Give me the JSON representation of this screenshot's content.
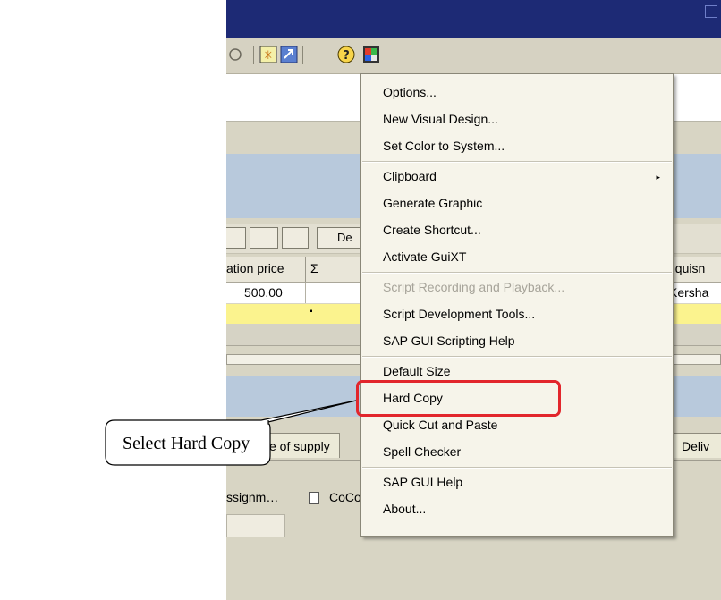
{
  "table": {
    "header_valuation": "ation price",
    "header_sigma": "Σ",
    "header_req": "equisn",
    "row_value": "500.00",
    "row_name": "Kersha",
    "yellow_marker": "▪"
  },
  "alv": {
    "detail_label": "De"
  },
  "tabs": [
    {
      "label": "ce of supply"
    },
    {
      "label": "Deliv"
    }
  ],
  "fields": {
    "assignment_label": "ssignm…",
    "coco_label": "CoCo"
  },
  "menu": {
    "items": [
      {
        "label": "Options..."
      },
      {
        "label": "New Visual Design..."
      },
      {
        "label": "Set Color to System..."
      },
      {
        "label": "Clipboard"
      },
      {
        "label": "Generate Graphic"
      },
      {
        "label": "Create Shortcut..."
      },
      {
        "label": "Activate GuiXT"
      },
      {
        "label": "Script Recording and Playback..."
      },
      {
        "label": "Script Development Tools..."
      },
      {
        "label": "SAP GUI Scripting Help"
      },
      {
        "label": "Default Size"
      },
      {
        "label": "Hard Copy"
      },
      {
        "label": "Quick Cut and Paste"
      },
      {
        "label": "Spell Checker"
      },
      {
        "label": "SAP GUI Help"
      },
      {
        "label": "About..."
      }
    ],
    "submenu_arrow": "▸"
  },
  "callout": {
    "text": "Select Hard Copy"
  },
  "colors": {
    "highlight": "#e2262c",
    "titlebar": "#1d2a75",
    "panel_blue": "#b8c9dc"
  },
  "icons": [
    "help-icon",
    "customize-layout-icon",
    "generate-shortcut-icon",
    "new-session-icon"
  ]
}
